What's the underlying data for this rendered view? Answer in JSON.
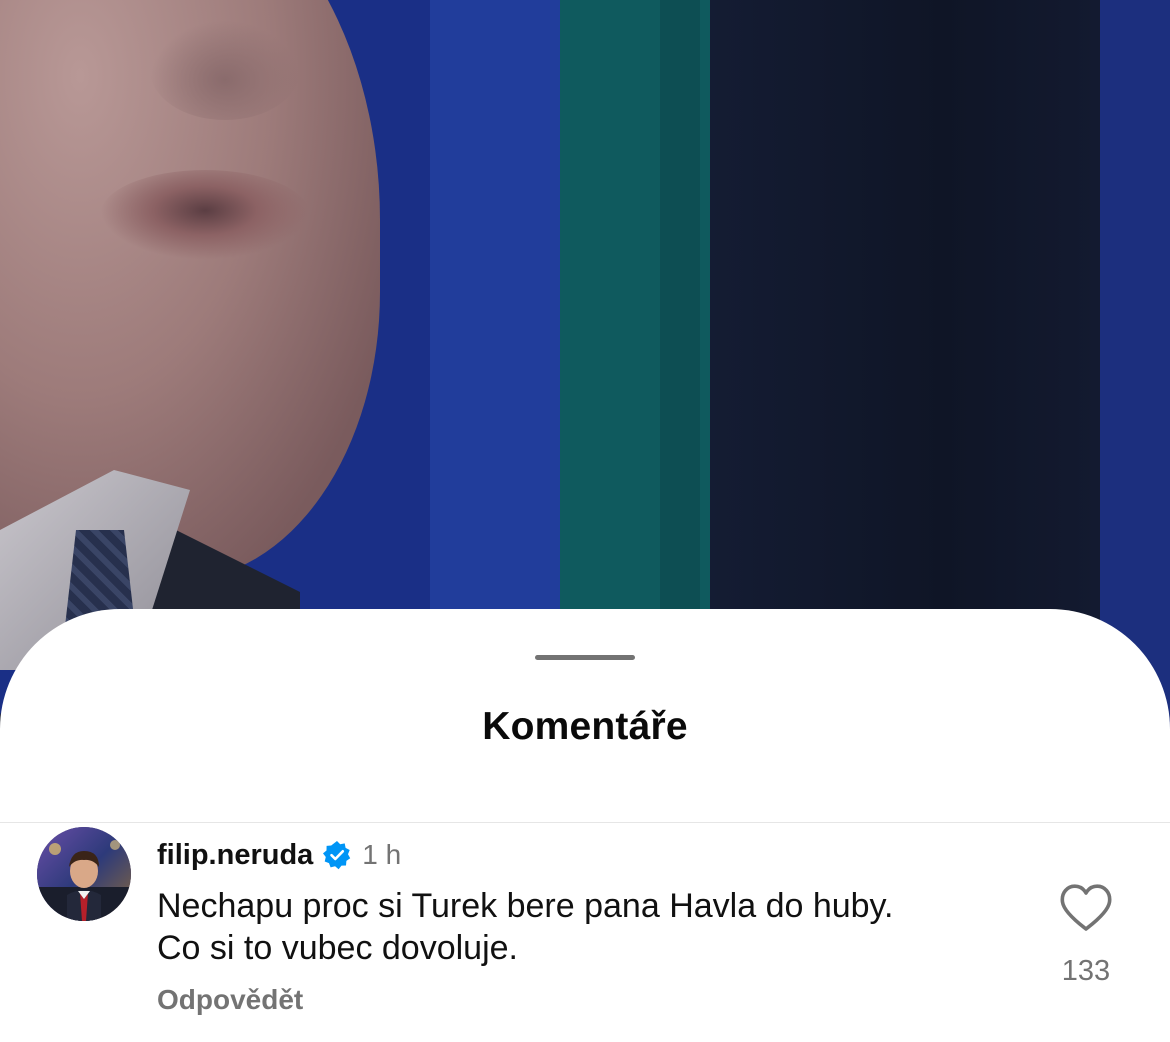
{
  "video": {
    "background": "news-studio-still-frame"
  },
  "comments_sheet": {
    "title": "Komentáře",
    "comments": [
      {
        "username": "filip.neruda",
        "verified": true,
        "verified_icon": "verified-badge-icon",
        "time": "1 h",
        "text_line_1": "Nechapu proc si Turek bere pana Havla do huby.",
        "text_line_2": "Co si to vubec dovoluje.",
        "reply_label": "Odpovědět",
        "like_icon": "heart-outline-icon",
        "like_count": "133"
      }
    ]
  },
  "colors": {
    "verified_blue": "#0095f6",
    "secondary_text": "#737373",
    "primary_text": "#111111"
  }
}
